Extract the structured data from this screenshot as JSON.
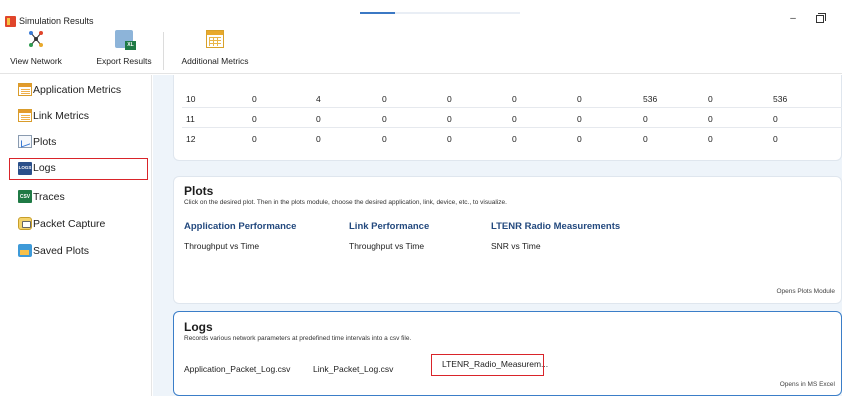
{
  "window": {
    "title": "Simulation Results"
  },
  "ribbon": {
    "view_network": "View Network",
    "export_results": "Export Results",
    "additional_metrics": "Additional Metrics"
  },
  "progress": {
    "fraction": 0.22
  },
  "sidebar": {
    "items": [
      {
        "label": "Application Metrics",
        "icon": "table-icon"
      },
      {
        "label": "Link Metrics",
        "icon": "table-icon"
      },
      {
        "label": "Plots",
        "icon": "plot-icon"
      },
      {
        "label": "Logs",
        "icon": "logs-icon",
        "selected": true
      },
      {
        "label": "Traces",
        "icon": "csv-icon"
      },
      {
        "label": "Packet Capture",
        "icon": "packet-capture-icon"
      },
      {
        "label": "Saved Plots",
        "icon": "saved-plots-icon"
      }
    ]
  },
  "table": {
    "rows": [
      [
        "10",
        "0",
        "4",
        "0",
        "0",
        "0",
        "0",
        "536",
        "0",
        "536"
      ],
      [
        "11",
        "0",
        "0",
        "0",
        "0",
        "0",
        "0",
        "0",
        "0",
        "0"
      ],
      [
        "12",
        "0",
        "0",
        "0",
        "0",
        "0",
        "0",
        "0",
        "0",
        "0"
      ]
    ]
  },
  "plots": {
    "title": "Plots",
    "description": "Click on the desired plot. Then in the plots module, choose the desired application, link, device, etc., to visualize.",
    "columns": [
      {
        "heading": "Application Performance",
        "item": "Throughput vs Time"
      },
      {
        "heading": "Link Performance",
        "item": "Throughput vs Time"
      },
      {
        "heading": "LTENR Radio Measurements",
        "item": "SNR vs Time"
      }
    ],
    "footer": "Opens Plots Module"
  },
  "logs": {
    "title": "Logs",
    "description": "Records various network parameters at predefined time intervals into a csv file.",
    "files": [
      "Application_Packet_Log.csv",
      "Link_Packet_Log.csv",
      "LTENR_Radio_Measurem..."
    ],
    "footer": "Opens in MS Excel"
  },
  "colors": {
    "accent": "#3b7ec8",
    "highlight": "#d9242a",
    "heading": "#23497e",
    "background": "#eef4fa"
  }
}
